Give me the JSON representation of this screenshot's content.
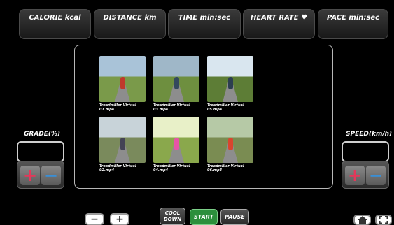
{
  "metrics": [
    {
      "label": "CALORIE kcal"
    },
    {
      "label": "DISTANCE km"
    },
    {
      "label": "TIME min:sec"
    },
    {
      "label": "HEART RATE ♥"
    },
    {
      "label": "PACE min:sec"
    }
  ],
  "grade": {
    "label": "GRADE(%)",
    "value": "",
    "plus": "+",
    "minus": "−"
  },
  "speed": {
    "label": "SPEED(km/h)",
    "value": "",
    "plus": "+",
    "minus": "−"
  },
  "videos": [
    {
      "caption": "Treadmiller Virtual 01.mp4",
      "sky": "#a9c3d8",
      "ground": "#7a9a4a",
      "runner": "#c0392b"
    },
    {
      "caption": "Treadmiller Virtual 03.mp4",
      "sky": "#9fb7c8",
      "ground": "#6e8f3f",
      "runner": "#34495e"
    },
    {
      "caption": "Treadmiller Virtual 05.mp4",
      "sky": "#d9e6ef",
      "ground": "#5d7d36",
      "runner": "#2c3e50"
    },
    {
      "caption": "Treadmiller Virtual 02.mp4",
      "sky": "#c8d3d9",
      "ground": "#7a8a5c",
      "runner": "#445"
    },
    {
      "caption": "Treadmiller Virtual 04.mp4",
      "sky": "#e8f0c8",
      "ground": "#8aa84c",
      "runner": "#e754a8"
    },
    {
      "caption": "Treadmiller Virtual 06.mp4",
      "sky": "#b6c9a6",
      "ground": "#7a8c52",
      "runner": "#d9452e"
    }
  ],
  "controls": {
    "minus": "−",
    "plus": "+",
    "cool_down": "COOL DOWN",
    "start": "START",
    "pause": "PAUSE"
  },
  "colors": {
    "start": "#2c8f3c",
    "plus": "#e4385a",
    "minus": "#3a8fd6"
  }
}
